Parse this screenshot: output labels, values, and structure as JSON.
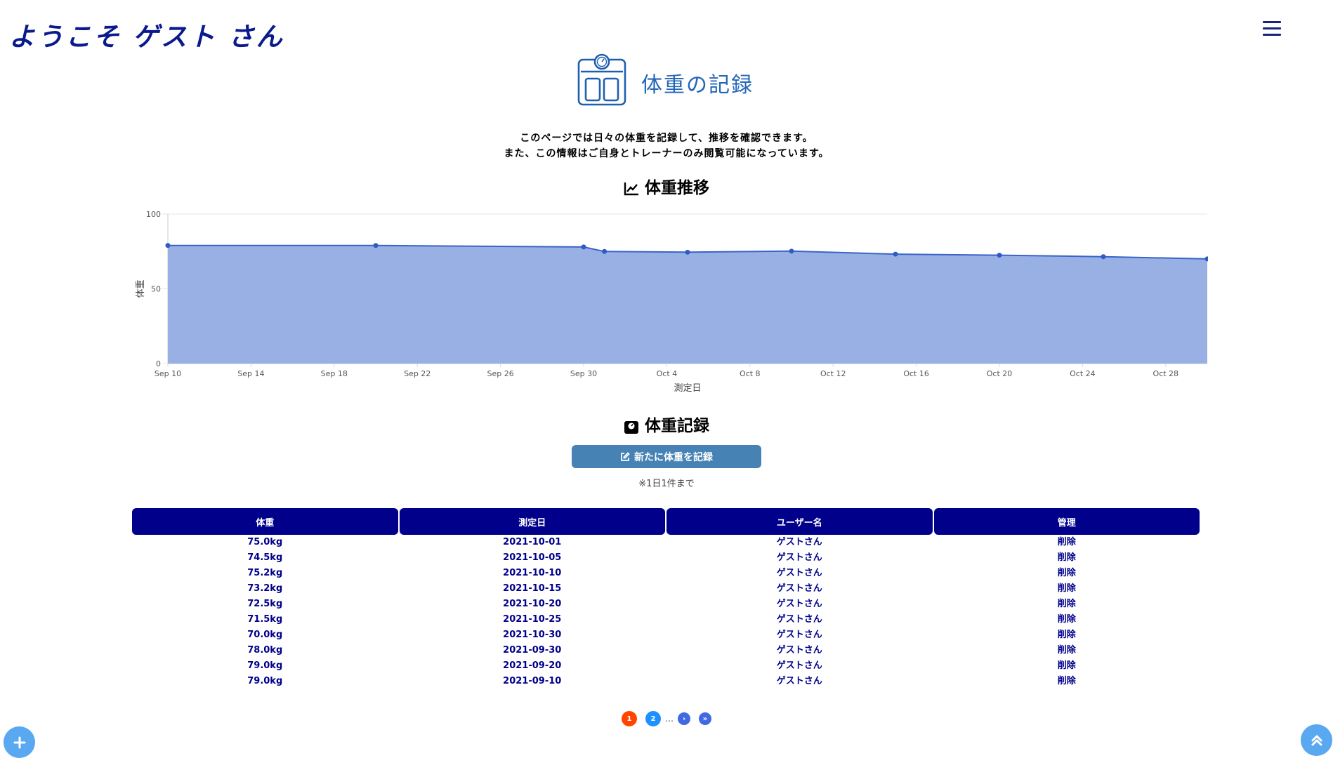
{
  "header": {
    "welcome": "ようこそ ゲスト さん",
    "menu_icon": "hamburger-menu-icon"
  },
  "page": {
    "title": "体重の記録",
    "title_icon": "weight-scale-icon",
    "intro_lines": [
      "このページでは日々の体重を記録して、推移を確認できます。",
      "また、この情報はご自身とトレーナーのみ閲覧可能になっています。"
    ]
  },
  "chart_section": {
    "title": "体重推移",
    "icon": "line-chart-icon"
  },
  "chart_data": {
    "type": "area",
    "title": "",
    "xlabel": "測定日",
    "ylabel": "体重",
    "ylim": [
      0,
      100
    ],
    "yticks": [
      0,
      50,
      100
    ],
    "x_range": [
      "2021-09-10",
      "2021-10-30"
    ],
    "xticks": [
      "Sep 10",
      "Sep 14",
      "Sep 18",
      "Sep 22",
      "Sep 26",
      "Sep 30",
      "Oct 4",
      "Oct 8",
      "Oct 12",
      "Oct 16",
      "Oct 20",
      "Oct 24",
      "Oct 28"
    ],
    "grid": true,
    "colors": {
      "line": "#3a64c8",
      "fill": "#98b0e4",
      "point": "#2f5bc3"
    },
    "series": [
      {
        "x": [
          "2021-09-10",
          "2021-09-20",
          "2021-09-30",
          "2021-10-01",
          "2021-10-05",
          "2021-10-10",
          "2021-10-15",
          "2021-10-20",
          "2021-10-25",
          "2021-10-30"
        ],
        "values": [
          79.0,
          79.0,
          78.0,
          75.0,
          74.5,
          75.2,
          73.2,
          72.5,
          71.5,
          70.0
        ]
      }
    ]
  },
  "records_section": {
    "title": "体重記録",
    "icon": "scale-icon",
    "new_record_label": "新たに体重を記録",
    "new_record_icon": "edit-icon",
    "note": "※1日1件まで"
  },
  "table": {
    "headers": [
      "体重",
      "測定日",
      "ユーザー名",
      "管理"
    ],
    "rows": [
      [
        "75.0kg",
        "2021-10-01",
        "ゲストさん",
        "削除"
      ],
      [
        "74.5kg",
        "2021-10-05",
        "ゲストさん",
        "削除"
      ],
      [
        "75.2kg",
        "2021-10-10",
        "ゲストさん",
        "削除"
      ],
      [
        "73.2kg",
        "2021-10-15",
        "ゲストさん",
        "削除"
      ],
      [
        "72.5kg",
        "2021-10-20",
        "ゲストさん",
        "削除"
      ],
      [
        "71.5kg",
        "2021-10-25",
        "ゲストさん",
        "削除"
      ],
      [
        "70.0kg",
        "2021-10-30",
        "ゲストさん",
        "削除"
      ],
      [
        "78.0kg",
        "2021-09-30",
        "ゲストさん",
        "削除"
      ],
      [
        "79.0kg",
        "2021-09-20",
        "ゲストさん",
        "削除"
      ],
      [
        "79.0kg",
        "2021-09-10",
        "ゲストさん",
        "削除"
      ]
    ]
  },
  "pagination": {
    "current": "1",
    "next_page": "2",
    "ellipsis": "…",
    "next": "›",
    "last": "»",
    "colors": {
      "current": "#ff4500",
      "page": "#1e90ff",
      "nav": "#4169e1"
    }
  },
  "fabs": {
    "add_icon": "plus-icon",
    "top_icon": "double-chevron-up-icon",
    "color": "#5aa9f0"
  }
}
